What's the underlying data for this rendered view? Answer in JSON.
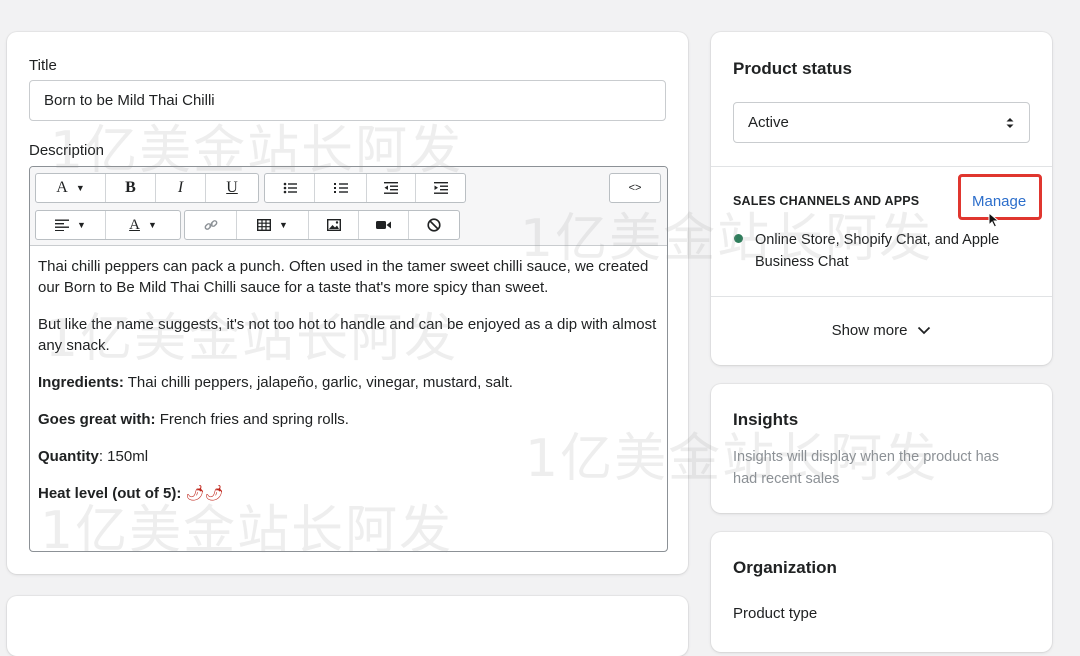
{
  "product": {
    "title_label": "Title",
    "title_value": "Born to be Mild Thai Chilli",
    "description_label": "Description",
    "description": {
      "p1": "Thai chilli peppers can pack a punch. Often used in the tamer sweet chilli sauce, we created our Born to Be Mild Thai Chilli sauce for a taste that's more spicy than sweet.",
      "p2": "But like the name suggests, it's not too hot to handle and can be enjoyed as a dip with almost any snack.",
      "ingredients_label": "Ingredients:",
      "ingredients_value": " Thai chilli peppers, jalapeño, garlic, vinegar, mustard, salt.",
      "goes_label": "Goes great with:",
      "goes_value": " French fries and spring rolls.",
      "quantity_label": "Quantity",
      "quantity_value": ": 150ml",
      "heat_label": "Heat level (out of 5):",
      "heat_value": " 🌶🌶"
    }
  },
  "toolbar": {
    "font": "A",
    "bold": "B",
    "italic": "I",
    "underline": "U",
    "code": "<>"
  },
  "status": {
    "heading": "Product status",
    "selected": "Active",
    "channels_heading": "SALES CHANNELS AND APPS",
    "manage": "Manage",
    "channels_text": "Online Store, Shopify Chat, and Apple Business Chat",
    "show_more": "Show more",
    "dot_color": "#2e7d5b"
  },
  "insights": {
    "heading": "Insights",
    "text": "Insights will display when the product has had recent sales"
  },
  "organization": {
    "heading": "Organization",
    "product_type_label": "Product type"
  },
  "watermark": "1亿美金站长阿发",
  "colors": {
    "link": "#2c6ecb",
    "highlight": "#e0362f"
  }
}
